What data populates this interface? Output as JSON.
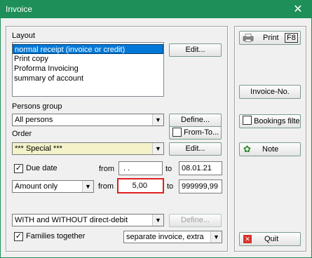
{
  "window": {
    "title": "Invoice",
    "close_glyph": "✕"
  },
  "layout": {
    "label": "Layout",
    "items": [
      "normal receipt (invoice or credit)",
      "Print copy",
      "Proforma Invoicing",
      "summary of account"
    ],
    "edit_button": "Edit..."
  },
  "persons_group": {
    "label": "Persons group",
    "value": "All persons",
    "define_button": "Define..."
  },
  "order": {
    "label": "Order",
    "from_to_label": "From-To...",
    "value": "*** Special ***",
    "edit_button": "Edit..."
  },
  "due_date": {
    "label": "Due date",
    "checked": true,
    "from_label": "from",
    "from_value": " .  .",
    "to_label": "to",
    "to_value": "08.01.21"
  },
  "amount": {
    "value": "Amount only",
    "from_label": "from",
    "from_value": "5,00",
    "to_label": "to",
    "to_value": "999999,99"
  },
  "direct_debit": {
    "value": "WITH and WITHOUT direct-debit",
    "define_button": "Define..."
  },
  "families": {
    "label": "Families together",
    "checked": true,
    "value": "separate invoice, extra"
  },
  "side": {
    "print_button": "Print",
    "print_key": "F8",
    "invoice_no_button": "Invoice-No.",
    "bookings_filter_label": "Bookings filter",
    "note_button": "Note",
    "quit_button": "Quit"
  },
  "colors": {
    "titlebar": "#1e8f59",
    "highlight": "#e02020",
    "selection": "#0078d7"
  }
}
